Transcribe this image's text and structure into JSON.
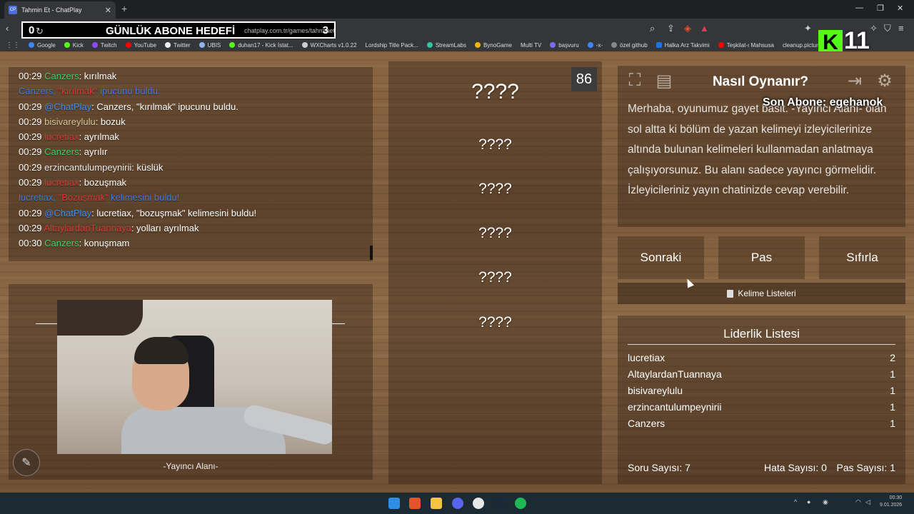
{
  "browser": {
    "tab_icon": "CP",
    "tab_title": "Tahmin Et - ChatPlay",
    "url": "chatplay.com.tr/games/tahminet",
    "overlay_left": "0",
    "overlay_goal": "GÜNLÜK ABONE HEDEFİ",
    "overlay_right": "3",
    "kick_logo": "K",
    "kick_count": "11",
    "bookmarks": [
      "Google",
      "Kick",
      "Twitch",
      "YouTube",
      "Twitter",
      "UBIS",
      "duhan17 - Kick İstat...",
      "WXCharts v1.0.22",
      "Lordship Title Pack...",
      "StreamLabs",
      "BynoGame",
      "Multi TV",
      "başvuru",
      "-x-",
      "özel github",
      "Halka Arz Takvimi",
      "Teşkilat-ı Mahsusa",
      "cleanup.pictures"
    ]
  },
  "chat": {
    "lines": [
      {
        "time": "00:29 ",
        "user": "Canzers",
        "user_color": "#3fcf6b",
        "text": ": kırılmak"
      },
      {
        "time": "",
        "user": "Canzers, ",
        "user_color": "#3e7ae0",
        "hidden": "\"kırılmak\"",
        "text": " ipucunu buldu.",
        "text_color": "#3e7ae0"
      },
      {
        "time": "00:29 ",
        "user": "@ChatPlay",
        "user_color": "#3e8ee8",
        "text": ": Canzers, \"kırılmak\" ipucunu buldu."
      },
      {
        "time": "00:29 ",
        "user": "bisivareylulu",
        "user_color": "#d6c79a",
        "text": ": bozuk"
      },
      {
        "time": "00:29 ",
        "user": "lucretiax",
        "user_color": "#d03a3a",
        "text": ": ayrılmak"
      },
      {
        "time": "00:29 ",
        "user": "Canzers",
        "user_color": "#3fcf6b",
        "text": ": ayrılır"
      },
      {
        "time": "00:29 ",
        "user": "erzincantulumpeynirii",
        "user_color": "#e8e8e8",
        "text": ": küslük"
      },
      {
        "time": "00:29 ",
        "user": "lucretiax",
        "user_color": "#d03a3a",
        "text": ": bozuşmak"
      },
      {
        "time": "",
        "user": "lucretiax, ",
        "user_color": "#3e7ae0",
        "hidden": "\"Bozuşmak\"",
        "text": " kelimesini buldu!",
        "text_color": "#3e7ae0"
      },
      {
        "time": "00:29 ",
        "user": "@ChatPlay",
        "user_color": "#3e8ee8",
        "text": ": lucretiax, \"bozuşmak\" kelimesini buldu!"
      },
      {
        "time": "00:29 ",
        "user": "AltaylardanTuannaya",
        "user_color": "#d03a3a",
        "text": ": yolları ayrılmak"
      },
      {
        "time": "00:30 ",
        "user": "Canzers",
        "user_color": "#3fcf6b",
        "text": ": konuşmam"
      }
    ]
  },
  "streamer": {
    "label": "-Yayıncı Alanı-"
  },
  "game": {
    "timer": "86",
    "main_word": "????",
    "forbidden_words": [
      "????",
      "????",
      "????",
      "????",
      "????"
    ]
  },
  "help": {
    "title": "Nasıl Oynanır?",
    "last_sub": "Son Abone: egehanok",
    "text": "Merhaba, oyunumuz gayet basit. -Yayıncı Alanı- olan sol altta ki bölüm de yazan kelimeyi izleyicilerinize altında bulunan kelimeleri kullanmadan anlatmaya çalışıyorsunuz. Bu alanı sadece yayıncı görmelidir. İzleyicileriniz yayın chatinizde cevap verebilir."
  },
  "actions": {
    "next": "Sonraki",
    "pass": "Pas",
    "reset": "Sıfırla",
    "word_lists": "Kelime Listeleri"
  },
  "leaderboard": {
    "title": "Liderlik Listesi",
    "rows": [
      {
        "name": "lucretiax",
        "score": "2"
      },
      {
        "name": "AltaylardanTuannaya",
        "score": "1"
      },
      {
        "name": "bisivareylulu",
        "score": "1"
      },
      {
        "name": "erzincantulumpeynirii",
        "score": "1"
      },
      {
        "name": "Canzers",
        "score": "1"
      }
    ],
    "questions": "Soru Sayısı: 7",
    "errors": "Hata Sayısı: 0",
    "passes": "Pas Sayısı: 1"
  },
  "taskbar": {
    "time": "00:30",
    "date": "9.01.2026"
  }
}
